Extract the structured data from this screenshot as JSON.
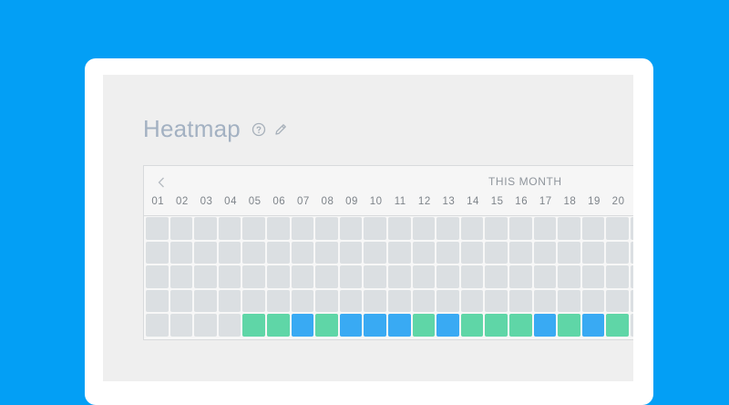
{
  "heatmap": {
    "title": "Heatmap",
    "help_icon": "question-circle-icon",
    "edit_icon": "pencil-icon",
    "prev_icon": "chevron-left-icon",
    "period_label": "THIS MONTH",
    "days": [
      "01",
      "02",
      "03",
      "04",
      "05",
      "06",
      "07",
      "08",
      "09",
      "10",
      "11",
      "12",
      "13",
      "14",
      "15",
      "16",
      "17",
      "18",
      "19",
      "20"
    ],
    "rows": [
      [
        "empty",
        "empty",
        "empty",
        "empty",
        "empty",
        "empty",
        "empty",
        "empty",
        "empty",
        "empty",
        "empty",
        "empty",
        "empty",
        "empty",
        "empty",
        "empty",
        "empty",
        "empty",
        "empty",
        "empty",
        "empty"
      ],
      [
        "empty",
        "empty",
        "empty",
        "empty",
        "empty",
        "empty",
        "empty",
        "empty",
        "empty",
        "empty",
        "empty",
        "empty",
        "empty",
        "empty",
        "empty",
        "empty",
        "empty",
        "empty",
        "empty",
        "empty",
        "empty"
      ],
      [
        "empty",
        "empty",
        "empty",
        "empty",
        "empty",
        "empty",
        "empty",
        "empty",
        "empty",
        "empty",
        "empty",
        "empty",
        "empty",
        "empty",
        "empty",
        "empty",
        "empty",
        "empty",
        "empty",
        "empty",
        "empty"
      ],
      [
        "empty",
        "empty",
        "empty",
        "empty",
        "empty",
        "empty",
        "empty",
        "empty",
        "empty",
        "empty",
        "empty",
        "empty",
        "empty",
        "empty",
        "empty",
        "empty",
        "empty",
        "empty",
        "empty",
        "empty",
        "empty"
      ],
      [
        "empty",
        "empty",
        "empty",
        "empty",
        "green",
        "green",
        "blue",
        "green",
        "blue",
        "blue",
        "blue",
        "green",
        "blue",
        "green",
        "green",
        "green",
        "blue",
        "green",
        "blue",
        "green",
        "empty"
      ]
    ],
    "colors": {
      "empty": "#dbdfe2",
      "green": "#5fd6a7",
      "blue": "#39aaf3",
      "background": "#039ff5"
    }
  }
}
